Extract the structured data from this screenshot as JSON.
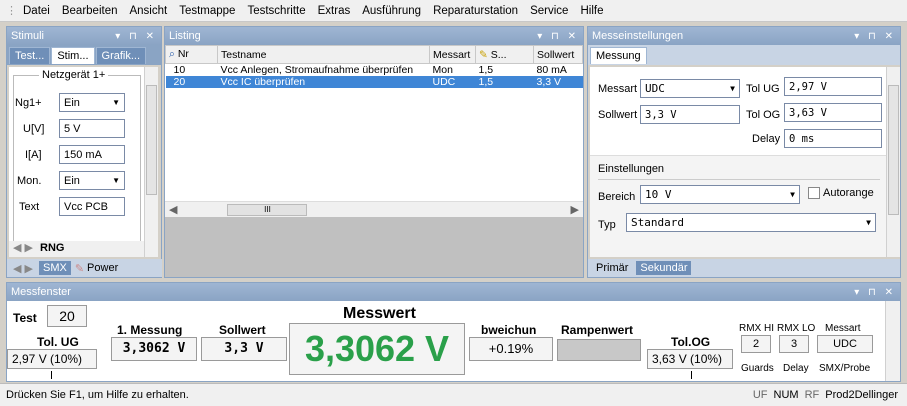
{
  "menu": [
    "Datei",
    "Bearbeiten",
    "Ansicht",
    "Testmappe",
    "Testschritte",
    "Extras",
    "Ausführung",
    "Reparaturstation",
    "Service",
    "Hilfe"
  ],
  "stimuli": {
    "title": "Stimuli",
    "tabs": [
      "Test...",
      "Stim...",
      "Grafik..."
    ],
    "group_title": "Netzgerät 1+",
    "rows": [
      {
        "label": "Ng1+",
        "value": "Ein"
      },
      {
        "label": "U[V]",
        "value": "5 V"
      },
      {
        "label": "I[A]",
        "value": "150 mA"
      },
      {
        "label": "Mon.",
        "value": "Ein"
      },
      {
        "label": "Text",
        "value": "Vcc PCB"
      }
    ],
    "bottom_tab1": "RNG",
    "bottom_tab2": "SMX",
    "bottom_tab3": "Power"
  },
  "listing": {
    "title": "Listing",
    "columns": [
      "Nr",
      "Testname",
      "Messart",
      "S...",
      "Sollwert"
    ],
    "rows": [
      {
        "nr": "10",
        "name": "Vcc Anlegen, Stromaufnahme überprüfen",
        "messart": "Mon",
        "s": "1,5",
        "soll": "80 mA",
        "selected": false
      },
      {
        "nr": "20",
        "name": "Vcc IC überprüfen",
        "messart": "UDC",
        "s": "1,5",
        "soll": "3,3 V",
        "selected": true
      }
    ],
    "scroll_glyph": "III"
  },
  "messeinstellungen": {
    "title": "Messeinstellungen",
    "tab": "Messung",
    "messart_label": "Messart",
    "messart": "UDC",
    "tolug_label": "Tol UG",
    "tolug": "2,97 V",
    "sollwert_label": "Sollwert",
    "sollwert": "3,3 V",
    "tolog_label": "Tol OG",
    "tolog": "3,63 V",
    "delay_label": "Delay",
    "delay": "0 ms",
    "einstellungen_label": "Einstellungen",
    "bereich_label": "Bereich",
    "bereich": "10 V",
    "autorange_label": "Autorange",
    "typ_label": "Typ",
    "typ": "Standard",
    "tab_primar": "Primär",
    "tab_sekundar": "Sekundär"
  },
  "messfenster": {
    "title": "Messfenster",
    "test_label": "Test",
    "test_value": "20",
    "tolug_label": "Tol. UG",
    "tolug_value": "2,97 V (10%)",
    "first_label": "1. Messung",
    "first_value": "3,3062 V",
    "soll_label": "Sollwert",
    "soll_value": "3,3 V",
    "messwert_label": "Messwert",
    "messwert_value": "3,3062 V",
    "abw_label": "bweichun",
    "abw_value": "+0.19%",
    "rampe_label": "Rampenwert",
    "tolog_label": "Tol.OG",
    "tolog_value": "3,63 V (10%)",
    "rmxhi_label": "RMX HI",
    "rmxhi_value": "2",
    "rmxlo_label": "RMX LO",
    "rmxlo_value": "3",
    "messart_label": "Messart",
    "messart_value": "UDC",
    "guards_label": "Guards",
    "delay_label": "Delay",
    "smx_label": "SMX/Probe"
  },
  "status": {
    "text": "Drücken Sie F1, um Hilfe zu erhalten.",
    "uf": "UF",
    "num": "NUM",
    "rf": "RF",
    "station": "Prod2Dellinger"
  },
  "colors": {
    "panel_title": "#8aa4c4",
    "selection": "#3f86d6",
    "pass": "#2aa04a"
  }
}
